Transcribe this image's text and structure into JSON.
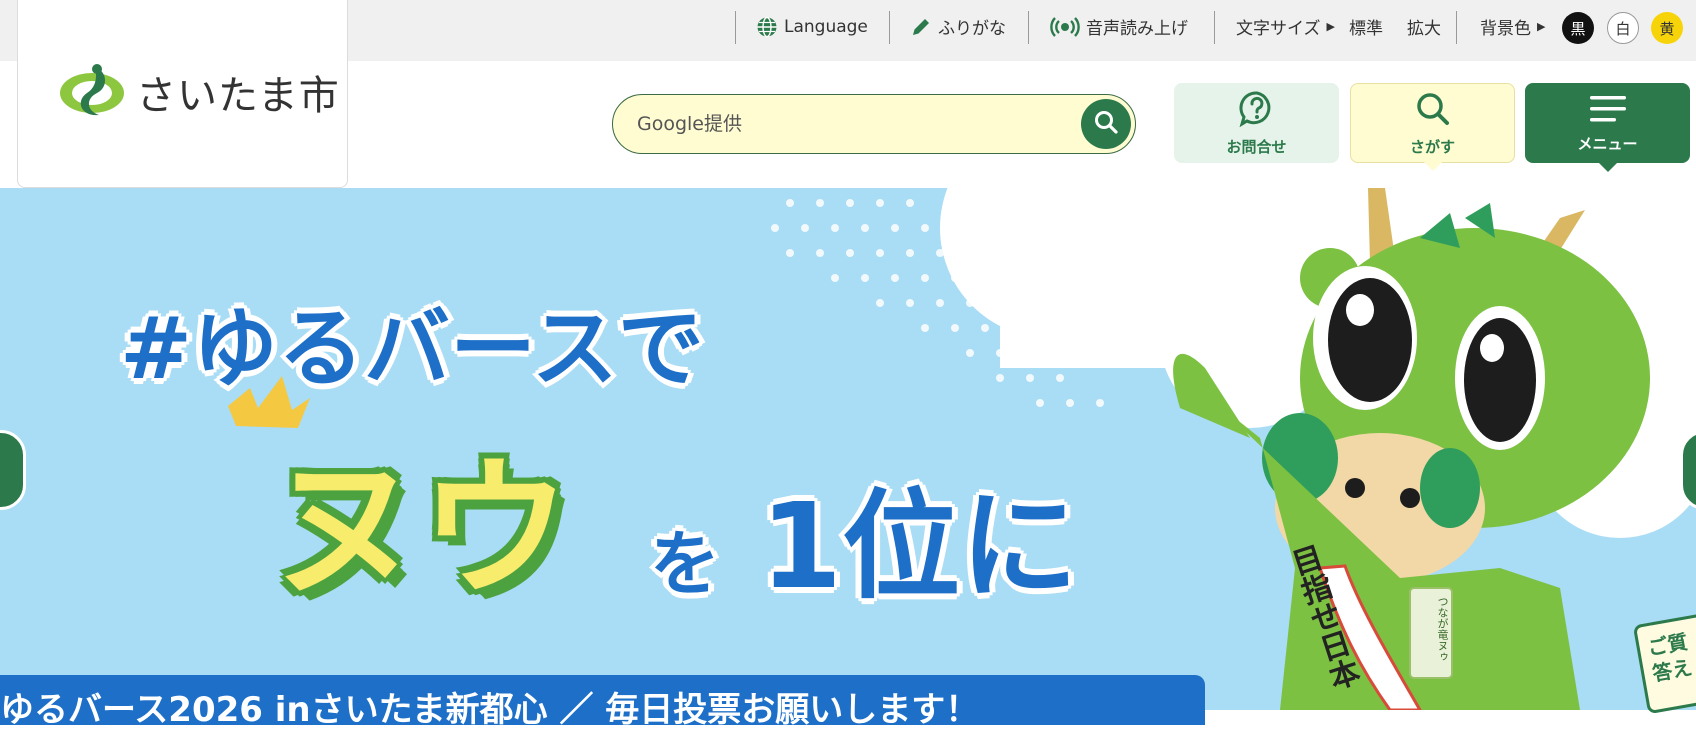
{
  "utility_bar": {
    "language_label": "Language",
    "furigana_label": "ふりがな",
    "read_aloud_label": "音声読み上げ",
    "font_size_label": "文字サイズ",
    "font_size_standard": "標準",
    "font_size_large": "拡大",
    "bg_color_label": "背景色",
    "bg_black": "黒",
    "bg_white": "白",
    "bg_yellow": "黄"
  },
  "header": {
    "logo_text": "さいたま市",
    "search_placeholder": "Google提供",
    "contact_label": "お問合せ",
    "find_label": "さがす",
    "menu_label": "メニュー"
  },
  "hero": {
    "hashtag_line": "#ゆるバースで",
    "mascot_name": "ヌウ",
    "rank_particle": "を",
    "rank_text": "1位に",
    "caption": "ゆるバース2026 inさいたま新都心 ／ 毎日投票お願いします！",
    "sash_text": "目指せ日本",
    "badge_text": "つなが竜ヌゥ",
    "question_card_line1": "ご質",
    "question_card_line2": "答え"
  },
  "colors": {
    "brand_green": "#2c7a4b",
    "search_bg": "#fffcd2",
    "hero_sky": "#a9dcf5",
    "text_blue": "#1d6fc8",
    "mascot_green": "#7cc142",
    "title_yellow": "#f8ec6c"
  },
  "icons": {
    "language": "globe-icon",
    "furigana": "pencil-icon",
    "read_aloud": "broadcast-icon",
    "search": "magnifier-icon",
    "contact": "question-bubble-icon",
    "menu": "hamburger-icon"
  }
}
